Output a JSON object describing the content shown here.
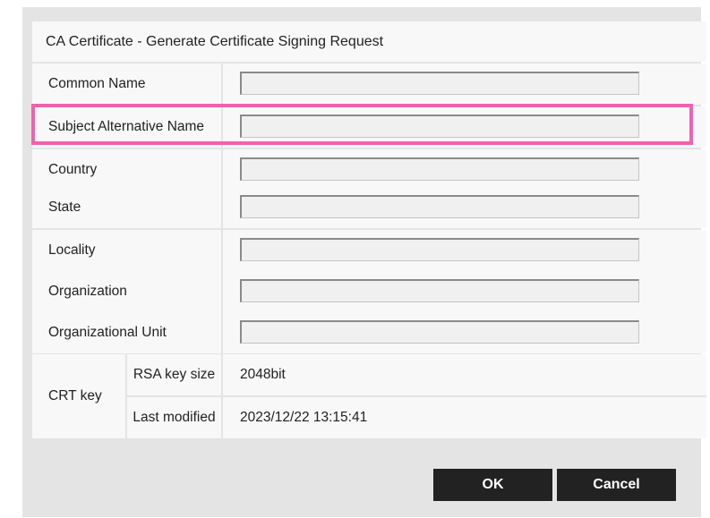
{
  "dialog": {
    "title": "CA Certificate - Generate Certificate Signing Request"
  },
  "fields": [
    {
      "label": "Common Name",
      "value": ""
    },
    {
      "label": "Subject Alternative Name",
      "value": ""
    },
    {
      "label": "Country",
      "value": ""
    },
    {
      "label": "State",
      "value": ""
    },
    {
      "label": "Locality",
      "value": ""
    },
    {
      "label": "Organization",
      "value": ""
    },
    {
      "label": "Organizational Unit",
      "value": ""
    }
  ],
  "crt_key": {
    "label": "CRT key",
    "rsa_key_size_label": "RSA key size",
    "rsa_key_size_value": "2048bit",
    "last_modified_label": "Last modified",
    "last_modified_value": "2023/12/22 13:15:41"
  },
  "buttons": {
    "ok": "OK",
    "cancel": "Cancel"
  },
  "colors": {
    "highlight": "#f062ad",
    "button_bg": "#222222",
    "panel_bg": "#e4e4e4"
  }
}
